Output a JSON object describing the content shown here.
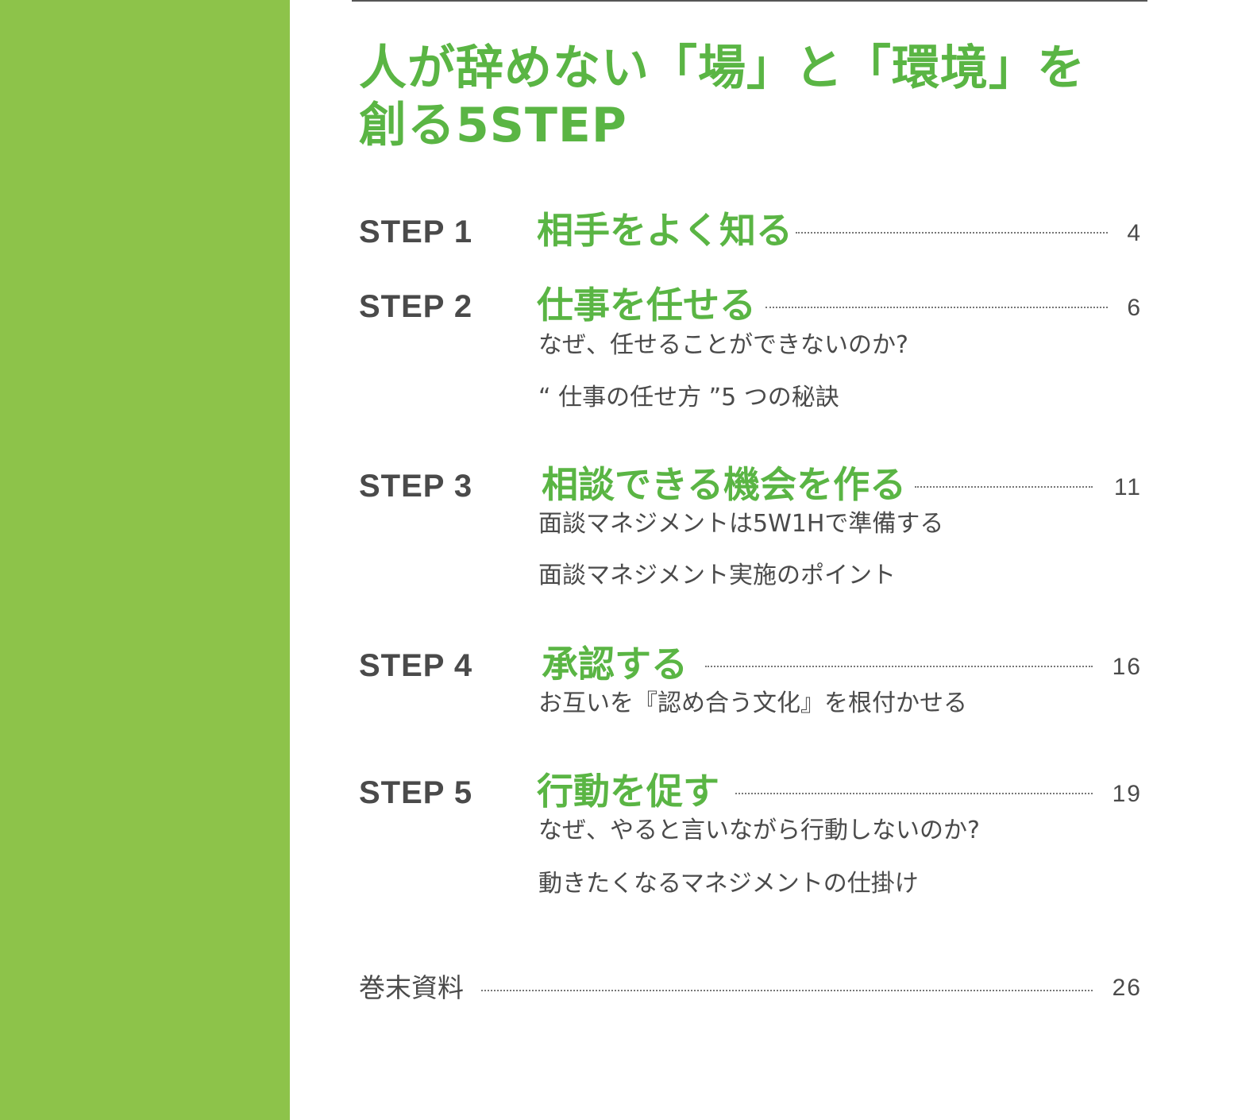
{
  "page": {
    "title_lines": [
      "人が辞めない「場」と「環境」を",
      "創る5STEP"
    ]
  },
  "toc": {
    "steps": [
      {
        "label": "STEP 1",
        "heading": "相手をよく知る",
        "page": "4",
        "items": []
      },
      {
        "label": "STEP 2",
        "heading": "仕事を任せる",
        "page": "6",
        "items": [
          "なぜ、任せることができないのか?",
          "“ 仕事の任せ方 ”5 つの秘訣"
        ]
      },
      {
        "label": "STEP 3",
        "heading": "相談できる機会を作る",
        "page": "11",
        "items": [
          "面談マネジメントは5W1Hで準備する",
          "面談マネジメント実施のポイント"
        ]
      },
      {
        "label": "STEP 4",
        "heading": "承認する",
        "page": "16",
        "items": [
          "お互いを『認め合う文化』を根付かせる"
        ]
      },
      {
        "label": "STEP 5",
        "heading": "行動を促す",
        "page": "19",
        "items": [
          "なぜ、やると言いながら行動しないのか?",
          "動きたくなるマネジメントの仕掛け"
        ]
      }
    ],
    "appendix": {
      "label": "巻末資料",
      "page": "26"
    }
  },
  "colors": {
    "accent_green": "#5ab544",
    "side_band": "#8dc34a",
    "text_gray": "#4a4a4a"
  }
}
